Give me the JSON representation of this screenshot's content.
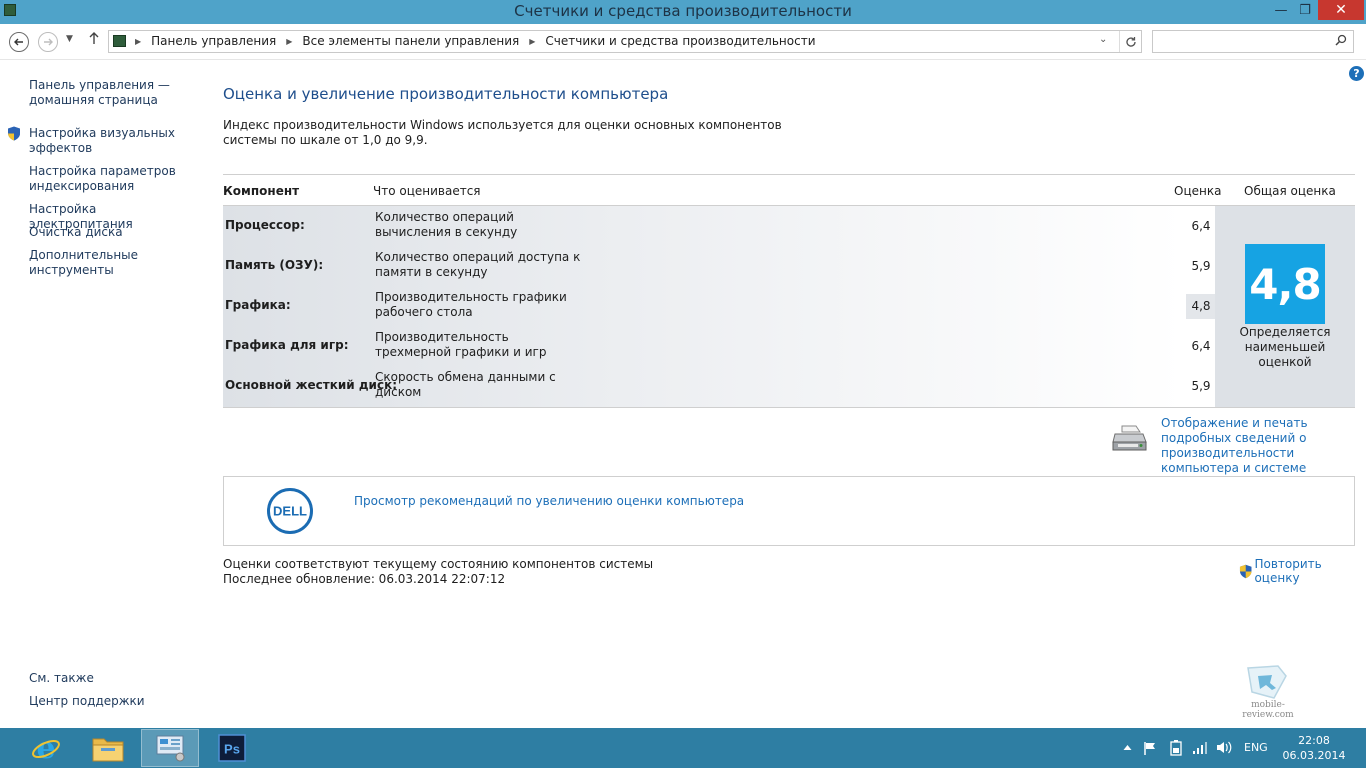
{
  "window": {
    "title": "Счетчики и средства производительности",
    "minimize_glyph": "—",
    "maximize_glyph": "❐",
    "close_glyph": "✕"
  },
  "address": {
    "crumbs": [
      "Панель управления",
      "Все элементы панели управления",
      "Счетчики и средства производительности"
    ],
    "search_placeholder": ""
  },
  "sidebar": {
    "items": [
      {
        "label": "Панель управления — домашняя страница",
        "shield": false
      },
      {
        "label": "Настройка визуальных эффектов",
        "shield": true
      },
      {
        "label": "Настройка параметров индексирования",
        "shield": false
      },
      {
        "label": "Настройка электропитания",
        "shield": false
      },
      {
        "label": "Очистка диска",
        "shield": false
      },
      {
        "label": "Дополнительные инструменты",
        "shield": false
      }
    ],
    "see_also": "См. также",
    "support": "Центр поддержки"
  },
  "main": {
    "heading": "Оценка и увеличение производительности компьютера",
    "description": "Индекс производительности Windows используется для оценки основных компонентов системы по шкале от 1,0 до 9,9.",
    "columns": {
      "component": "Компонент",
      "what": "Что оценивается",
      "score": "Оценка",
      "total": "Общая оценка"
    },
    "rows": [
      {
        "component": "Процессор:",
        "what": "Количество операций вычисления в секунду",
        "score": "6,4",
        "lowest": false
      },
      {
        "component": "Память (ОЗУ):",
        "what": "Количество операций доступа к памяти в секунду",
        "score": "5,9",
        "lowest": false
      },
      {
        "component": "Графика:",
        "what": "Производительность графики рабочего стола",
        "score": "4,8",
        "lowest": true
      },
      {
        "component": "Графика для игр:",
        "what": "Производительность трехмерной графики и игр",
        "score": "6,4",
        "lowest": false
      },
      {
        "component": "Основной жесткий диск:",
        "what": "Скорость обмена данными с диском",
        "score": "5,9",
        "lowest": false
      }
    ],
    "base_score": "4,8",
    "base_caption": "Определяется наименьшей оценкой",
    "print_link": "Отображение и печать подробных сведений о производительности компьютера и системе",
    "dell_link": "Просмотр рекомендаций по увеличению оценки компьютера",
    "dell_logo_text": "DELL",
    "status_line": "Оценки соответствуют текущему состоянию компонентов системы",
    "last_update": "Последнее обновление: 06.03.2014 22:07:12",
    "rerun": "Повторить оценку"
  },
  "watermark": "mobile-review.com",
  "taskbar": {
    "apps": [
      "internet-explorer",
      "file-explorer",
      "control-panel",
      "photoshop"
    ],
    "photoshop_label": "Ps",
    "language": "ENG",
    "time": "22:08",
    "date": "06.03.2014"
  },
  "colors": {
    "titlebar": "#4fa3c9",
    "taskbar": "#2e7ea3",
    "link": "#1d6fb8",
    "score_tile": "#16a3e3",
    "close": "#c7372f"
  }
}
